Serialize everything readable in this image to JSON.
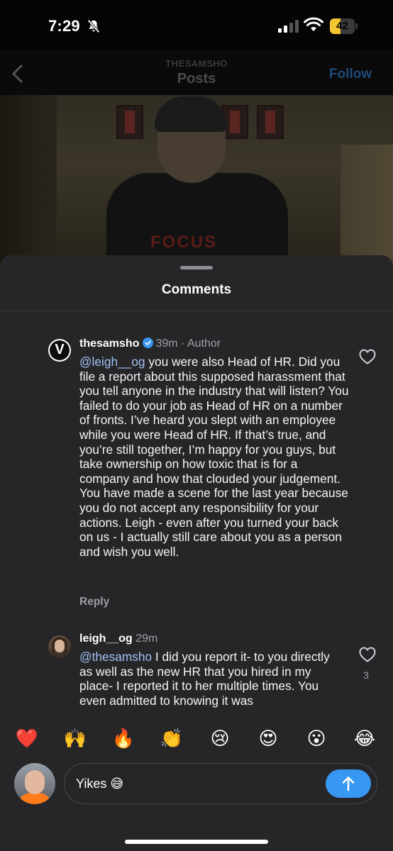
{
  "status_bar": {
    "time": "7:29",
    "battery_level": "42",
    "battery_fraction": 0.42,
    "icons": [
      "bell-slash-icon",
      "cellular-signal-icon",
      "wifi-icon",
      "battery-icon"
    ]
  },
  "header": {
    "account": "THESAMSHO",
    "title": "Posts",
    "follow_label": "Follow",
    "accent": "#1d4b78"
  },
  "video": {
    "shirt_text": "FOCUS"
  },
  "sheet": {
    "title": "Comments",
    "background": "#262629"
  },
  "comments": [
    {
      "username": "thesamsho",
      "avatar_letter": "V",
      "verified": true,
      "time": "39m",
      "role": "Author",
      "mention": "@leigh__og",
      "text": "you were also Head of HR. Did you file a report about this supposed harassment that you tell anyone in the industry that will listen? You failed to do your job as Head of HR on a number of fronts. I’ve heard you slept with an employee while you were Head of HR. If that’s true, and you’re still together, I’m happy for you guys, but take ownership on how toxic that is for a company and how that clouded your judgement. You have made a scene for the last year because you do not accept any responsibility for your actions. Leigh - even after you turned your back on us - I actually still care about you as a person and wish you well.",
      "reply_label": "Reply"
    },
    {
      "username": "leigh__og",
      "time": "29m",
      "mention": "@thesamsho",
      "text": "I did you report it- to you directly as well as the new HR that you hired in my place- I reported it to her multiple times. You even admitted to knowing it was",
      "like_count": "3"
    }
  ],
  "emoji_bar": [
    {
      "name": "heart",
      "glyph": "❤️"
    },
    {
      "name": "raised-hands",
      "glyph": "🙌"
    },
    {
      "name": "fire",
      "glyph": "🔥"
    },
    {
      "name": "clapping-hands",
      "glyph": "👏"
    },
    {
      "name": "crying-face",
      "glyph": "😢"
    },
    {
      "name": "heart-eyes",
      "glyph": "😍"
    },
    {
      "name": "surprised-face",
      "glyph": "😮"
    },
    {
      "name": "tears-of-joy",
      "glyph": "😂"
    }
  ],
  "composer": {
    "input_value": "Yikes 😅",
    "send_color": "#3897f0"
  }
}
